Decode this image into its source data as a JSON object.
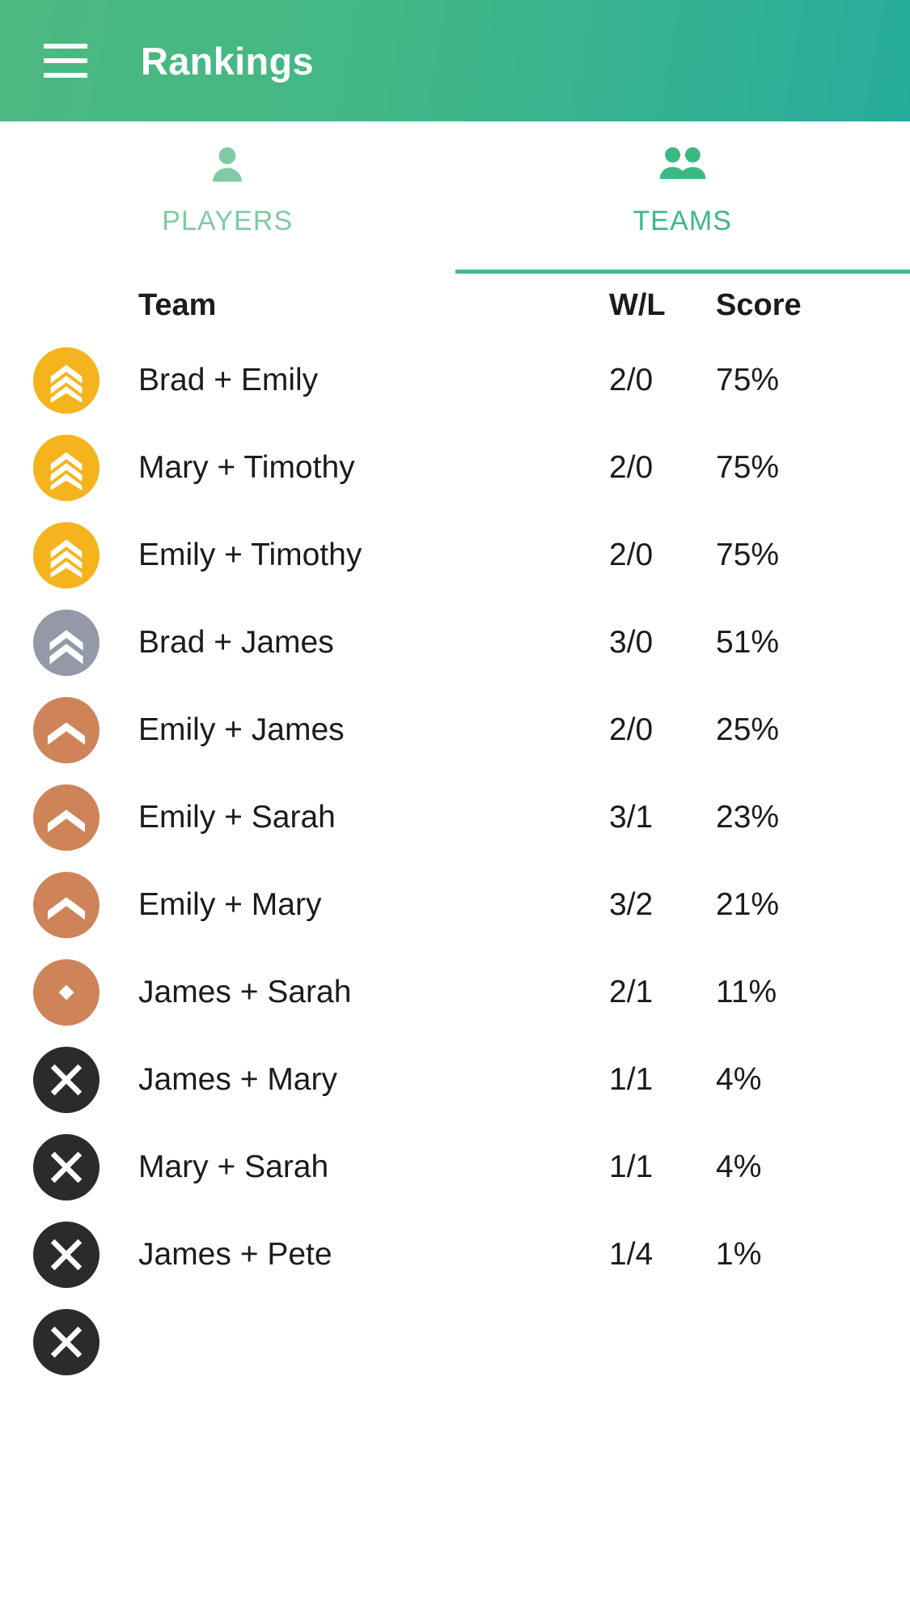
{
  "appbar": {
    "title": "Rankings",
    "menu_icon": "hamburger-menu-icon",
    "gradient_from": "#4cb980",
    "gradient_to": "#27ac9c"
  },
  "tabs": [
    {
      "label": "PLAYERS",
      "icon": "person-icon",
      "active": false,
      "color": "#7fcaa3"
    },
    {
      "label": "TEAMS",
      "icon": "people-icon",
      "active": true,
      "color": "#3cb883"
    }
  ],
  "tab_indicator_color": "#46b985",
  "table": {
    "columns": {
      "badge": "",
      "team": "Team",
      "wl": "W/L",
      "score": "Score"
    },
    "rows": [
      {
        "badge": "rank-gold-triple-chevron-icon",
        "badge_color": "#F5B41D",
        "team": "Brad + Emily",
        "wl": "2/0",
        "score": "75%"
      },
      {
        "badge": "rank-gold-triple-chevron-icon",
        "badge_color": "#F5B41D",
        "team": "Mary + Timothy",
        "wl": "2/0",
        "score": "75%"
      },
      {
        "badge": "rank-gold-triple-chevron-icon",
        "badge_color": "#F5B41D",
        "team": "Emily + Timothy",
        "wl": "2/0",
        "score": "75%"
      },
      {
        "badge": "rank-silver-double-chevron-icon",
        "badge_color": "#9499A8",
        "team": "Brad + James",
        "wl": "3/0",
        "score": "51%"
      },
      {
        "badge": "rank-bronze-chevron-icon",
        "badge_color": "#CE8458",
        "team": "Emily + James",
        "wl": "2/0",
        "score": "25%"
      },
      {
        "badge": "rank-bronze-chevron-icon",
        "badge_color": "#CE8458",
        "team": "Emily + Sarah",
        "wl": "3/1",
        "score": "23%"
      },
      {
        "badge": "rank-bronze-chevron-icon",
        "badge_color": "#CE8458",
        "team": "Emily + Mary",
        "wl": "3/2",
        "score": "21%"
      },
      {
        "badge": "rank-bronze-diamond-icon",
        "badge_color": "#CE8458",
        "team": "James + Sarah",
        "wl": "2/1",
        "score": "11%"
      },
      {
        "badge": "rank-x-icon",
        "badge_color": "#2B2B2B",
        "team": "James + Mary",
        "wl": "1/1",
        "score": "4%"
      },
      {
        "badge": "rank-x-icon",
        "badge_color": "#2B2B2B",
        "team": "Mary + Sarah",
        "wl": "1/1",
        "score": "4%"
      },
      {
        "badge": "rank-x-icon",
        "badge_color": "#2B2B2B",
        "team": "James + Pete",
        "wl": "1/4",
        "score": "1%"
      },
      {
        "badge": "rank-x-icon",
        "badge_color": "#2B2B2B",
        "team": "",
        "wl": "",
        "score": ""
      }
    ]
  }
}
